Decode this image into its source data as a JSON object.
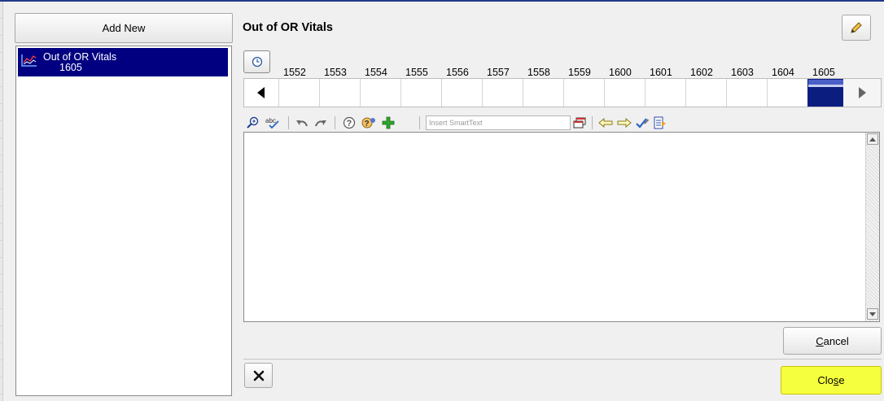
{
  "sidebar": {
    "add_new_label": "Add New",
    "items": [
      {
        "label": "Out of OR Vitals",
        "time": "1605",
        "selected": true,
        "icon": "chart-icon"
      }
    ]
  },
  "header": {
    "title": "Out of OR Vitals",
    "edit_icon": "pencil-icon"
  },
  "timeline": {
    "clock_icon": "clock-icon",
    "times": [
      "1552",
      "1553",
      "1554",
      "1555",
      "1556",
      "1557",
      "1558",
      "1559",
      "1600",
      "1601",
      "1602",
      "1603",
      "1604",
      "1605"
    ],
    "selected_time": "1605"
  },
  "toolbar": {
    "icons": [
      "zoom-icon",
      "spellcheck-icon",
      "undo-icon",
      "redo-icon",
      "help-icon",
      "help-users-icon",
      "add-icon",
      "smarttext-window-icon",
      "arrow-left-icon",
      "arrow-right-icon",
      "check-pen-icon",
      "document-icon"
    ],
    "smarttext_placeholder": "Insert SmartText"
  },
  "editor": {
    "content": ""
  },
  "buttons": {
    "cancel_pre": "",
    "cancel_u": "C",
    "cancel_post": "ancel",
    "close_pre": "Clo",
    "close_u": "s",
    "close_post": "e",
    "delete_icon": "x-icon"
  },
  "colors": {
    "selection": "#000080",
    "highlight": "#f6ff3e"
  }
}
